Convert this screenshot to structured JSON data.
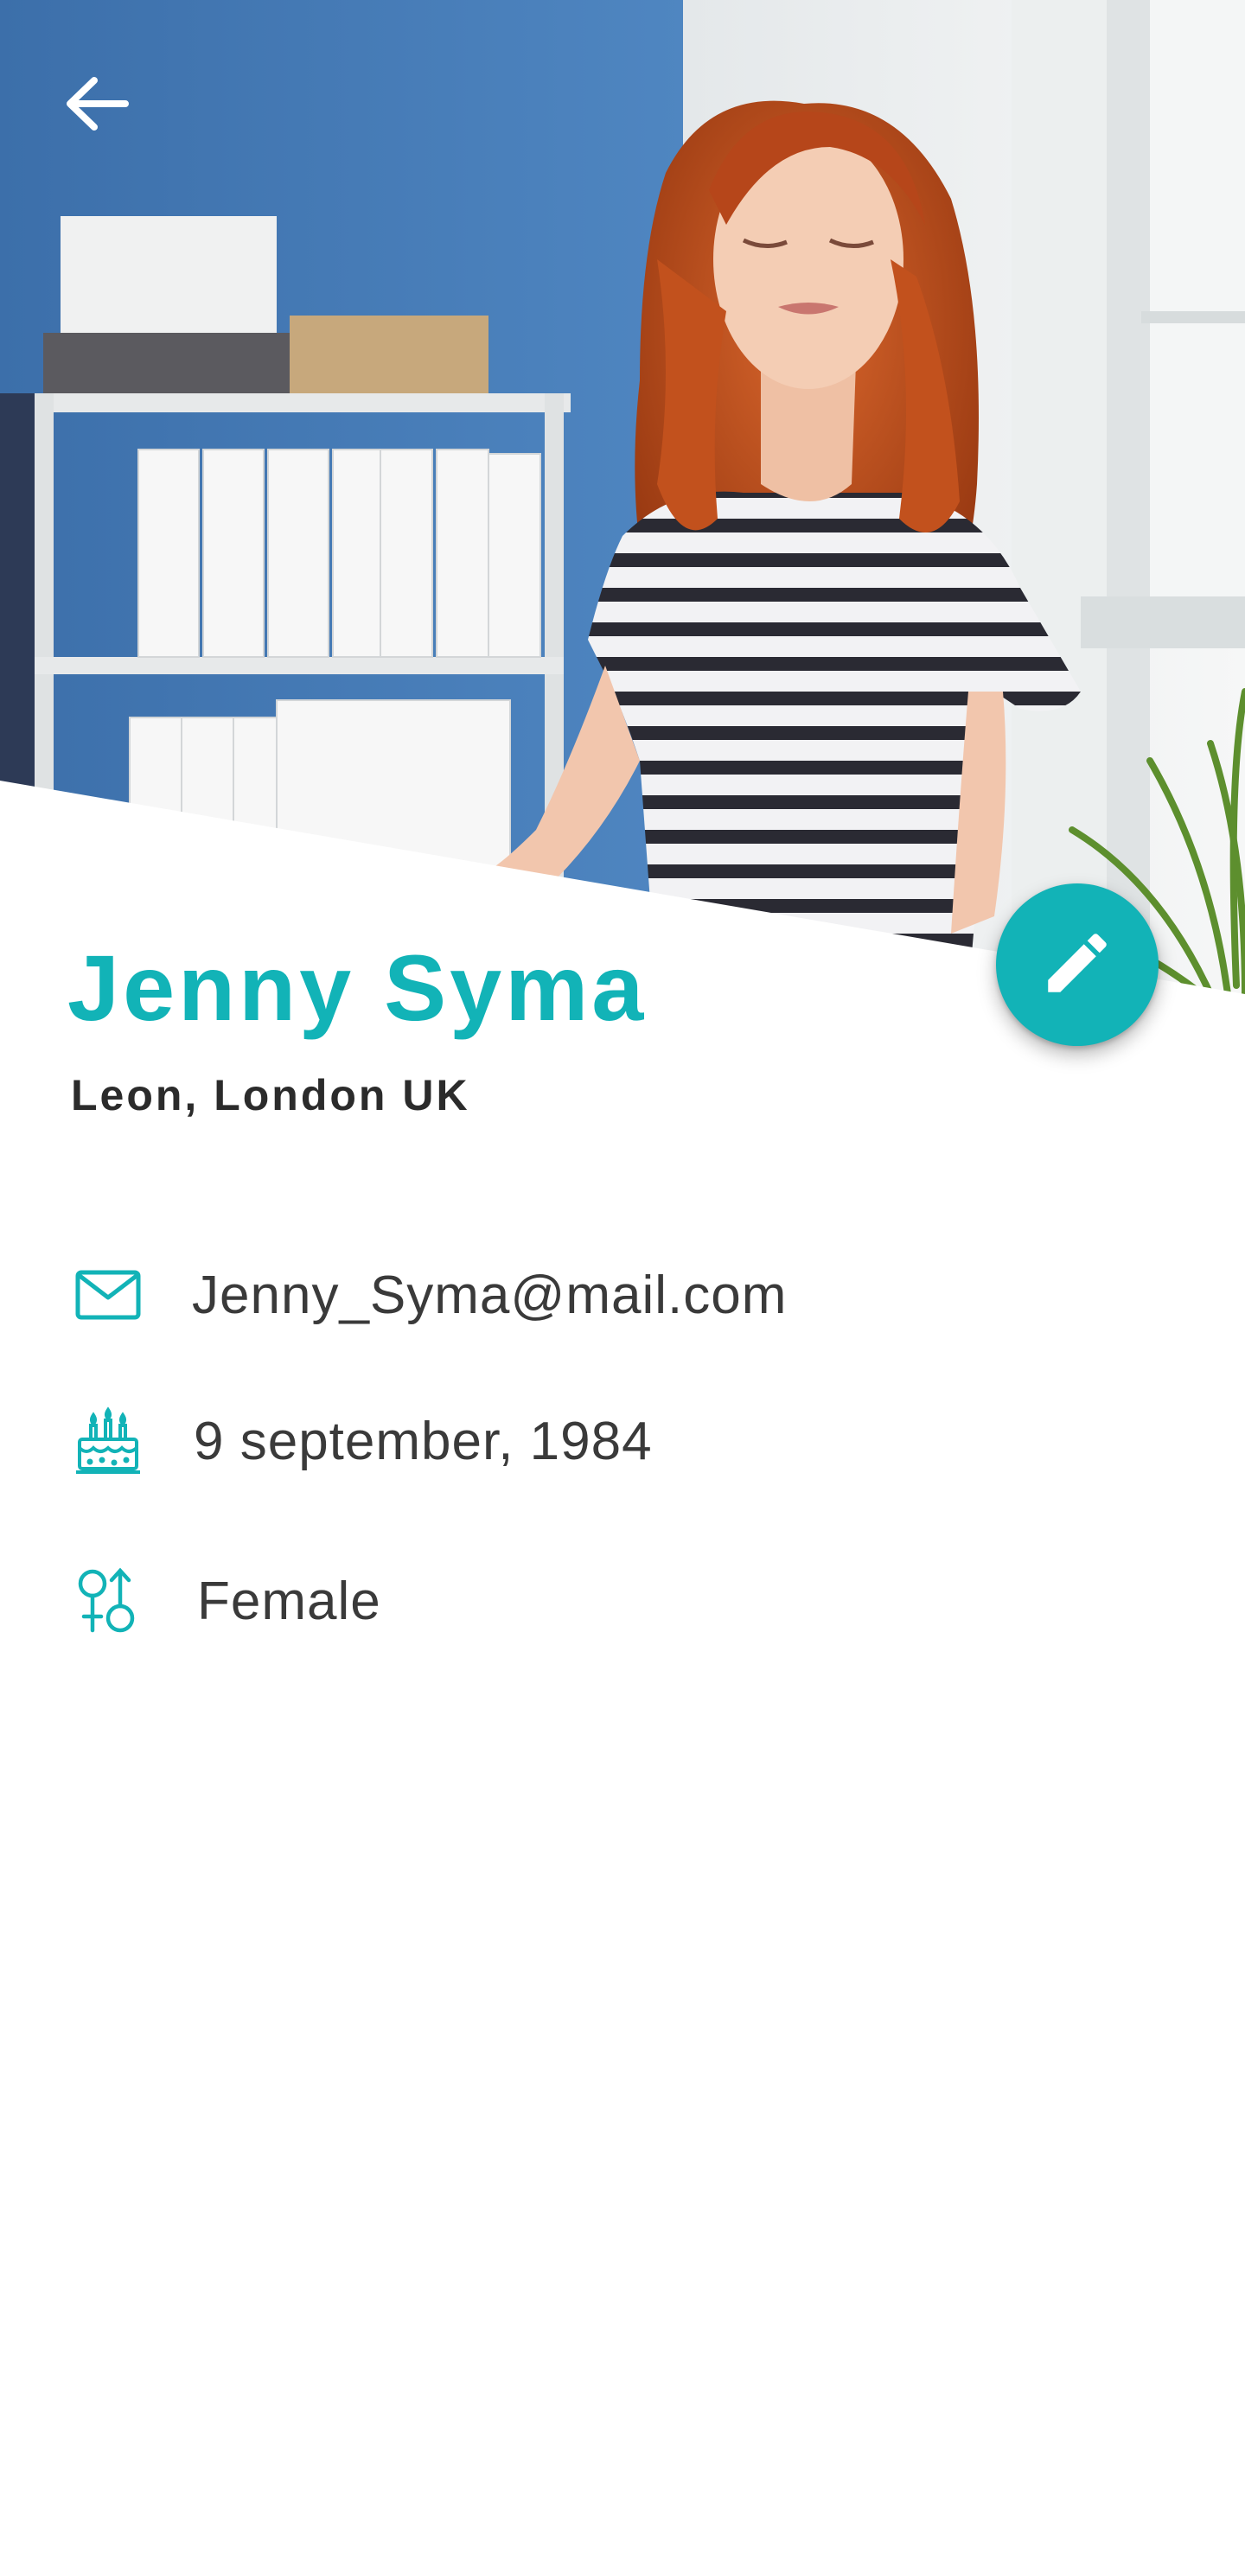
{
  "profile": {
    "name": "Jenny Syma",
    "location": "Leon, London UK"
  },
  "details": {
    "email": "Jenny_Syma@mail.com",
    "birthday": "9 september, 1984",
    "gender": "Female"
  },
  "colors": {
    "accent": "#12b3b7",
    "text": "#3a3a3a",
    "subtitle": "#2b2b2b"
  },
  "icons": {
    "back": "arrow-left-icon",
    "edit": "pencil-icon",
    "email": "envelope-icon",
    "birthday": "birthday-cake-icon",
    "gender": "gender-icon"
  }
}
